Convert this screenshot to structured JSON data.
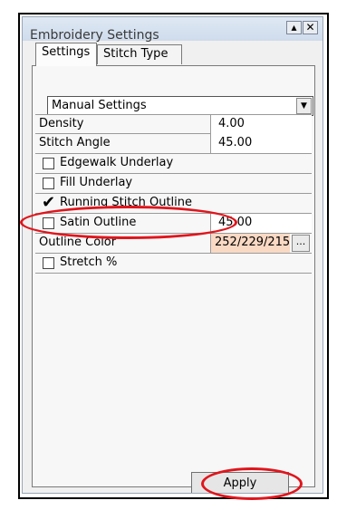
{
  "window": {
    "title": "Embroidery Settings",
    "minimize_label": "▴",
    "close_label": "✕"
  },
  "tabs": [
    {
      "label": "Settings"
    },
    {
      "label": "Stitch Type"
    }
  ],
  "dropdown": {
    "selected": "Manual Settings"
  },
  "properties": {
    "density": {
      "label": "Density",
      "value": "4.00"
    },
    "stitch_angle": {
      "label": "Stitch Angle",
      "value": "45.00"
    },
    "edgewalk_underlay": {
      "label": "Edgewalk Underlay",
      "checked": false
    },
    "fill_underlay": {
      "label": "Fill Underlay",
      "checked": false
    },
    "running_stitch_outline": {
      "label": "Running Stitch Outline",
      "checked": true
    },
    "satin_outline": {
      "label": "Satin Outline",
      "checked": false,
      "value": "45.00"
    },
    "outline_color": {
      "label": "Outline Color",
      "value": "252/229/215",
      "button_label": "...",
      "swatch": "#fcd9c6"
    },
    "stretch": {
      "label": "Stretch %",
      "checked": false
    }
  },
  "apply_label": "Apply",
  "colors": {
    "callout": "#e0151c",
    "titlebar": "#dfe8f4"
  }
}
